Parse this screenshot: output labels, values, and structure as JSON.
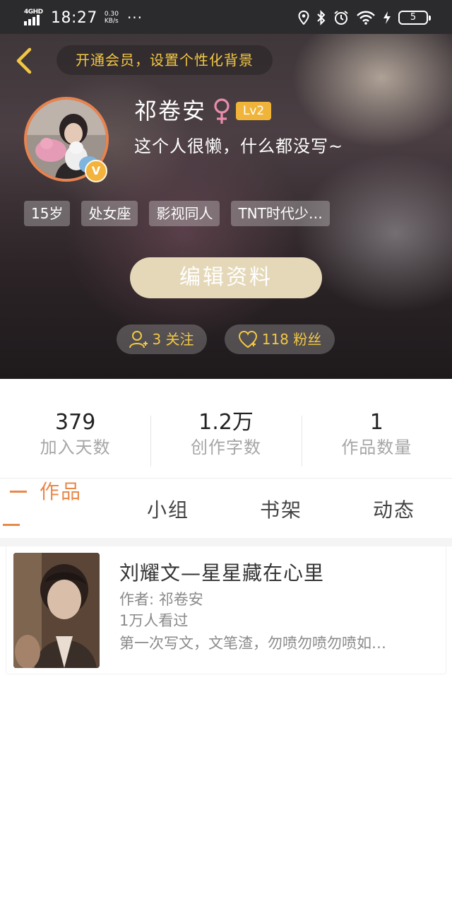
{
  "status_bar": {
    "network": "4GHD",
    "time": "18:27",
    "speed_value": "0.30",
    "speed_unit": "KB/s",
    "more": "···",
    "battery": "5"
  },
  "header": {
    "vip_banner": "开通会员，设置个性化背景",
    "username": "祁卷安",
    "level": "Lv2",
    "bio": "这个人很懒，什么都没写~",
    "avatar_badge": "V",
    "tags": [
      "15岁",
      "处女座",
      "影视同人",
      "TNT时代少…"
    ],
    "edit_button": "编辑资料",
    "following_label": "3 关注",
    "fans_label": "118 粉丝",
    "accent_color": "#f2c744"
  },
  "stats": [
    {
      "value": "379",
      "label": "加入天数"
    },
    {
      "value": "1.2万",
      "label": "创作字数"
    },
    {
      "value": "1",
      "label": "作品数量"
    }
  ],
  "tabs": [
    {
      "label": "作品",
      "active": true
    },
    {
      "label": "小组",
      "active": false
    },
    {
      "label": "书架",
      "active": false
    },
    {
      "label": "动态",
      "active": false
    }
  ],
  "tab_active_color": "#e8894a",
  "works": [
    {
      "title": "刘耀文—星星藏在心里",
      "author": "作者: 祁卷安",
      "views": "1万人看过",
      "description": "第一次写文，文笔渣，勿喷勿喷勿喷如…"
    }
  ]
}
